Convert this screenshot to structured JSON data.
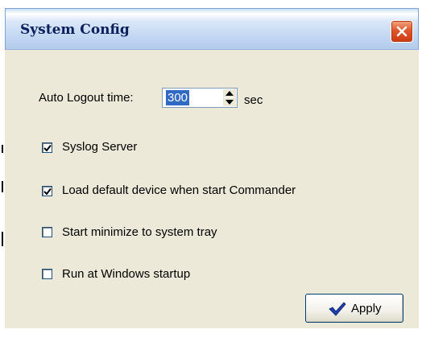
{
  "window": {
    "title": "System Config",
    "close_label": "close"
  },
  "auto_logout": {
    "label": "Auto Logout time:",
    "value": "300",
    "unit": "sec"
  },
  "options": [
    {
      "label": "Syslog Server",
      "checked": true
    },
    {
      "label": "Load default device when start Commander",
      "checked": true
    },
    {
      "label": "Start minimize to system tray",
      "checked": false
    },
    {
      "label": "Run at Windows startup",
      "checked": false
    }
  ],
  "apply": {
    "label": "Apply"
  },
  "colors": {
    "dialog_background": "#ece9d8",
    "title_text": "#0a1f5c",
    "close_button": "#e0562a",
    "selection": "#316ac5",
    "apply_icon": "#1f3fb0"
  },
  "icons": {
    "close": "close-icon",
    "spin_up": "spin-up-icon",
    "spin_down": "spin-down-icon",
    "check": "checkmark-icon",
    "apply": "checkmark-icon"
  }
}
